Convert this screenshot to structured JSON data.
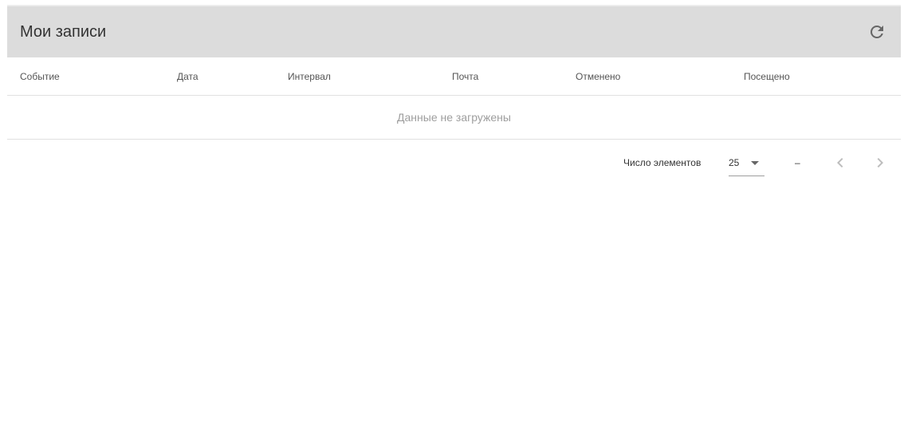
{
  "header": {
    "title": "Мои записи",
    "refresh_icon": "refresh-icon"
  },
  "table": {
    "columns": [
      "Событие",
      "Дата",
      "Интервал",
      "Почта",
      "Отменено",
      "Посещено"
    ],
    "empty_message": "Данные не загружены"
  },
  "paginator": {
    "items_per_page_label": "Число элементов",
    "page_size": "25",
    "range_label": "–",
    "prev_icon": "chevron-left-icon",
    "next_icon": "chevron-right-icon"
  },
  "colors": {
    "header_bg": "#dcdcdc",
    "empty_text": "#9e9e9e",
    "disabled_icon": "#bdbdbd"
  }
}
